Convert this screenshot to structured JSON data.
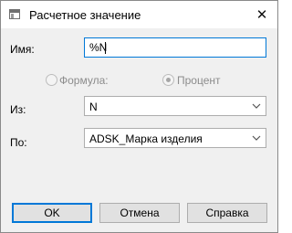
{
  "window": {
    "title": "Расчетное значение",
    "close_glyph": "✕"
  },
  "form": {
    "name_label": "Имя:",
    "name_value": "%N",
    "formula_label": "Формула:",
    "percent_label": "Процент",
    "from_label": "Из:",
    "from_value": "N",
    "by_label": "По:",
    "by_value": "ADSK_Марка изделия"
  },
  "buttons": {
    "ok": "OK",
    "cancel": "Отмена",
    "help": "Справка"
  }
}
